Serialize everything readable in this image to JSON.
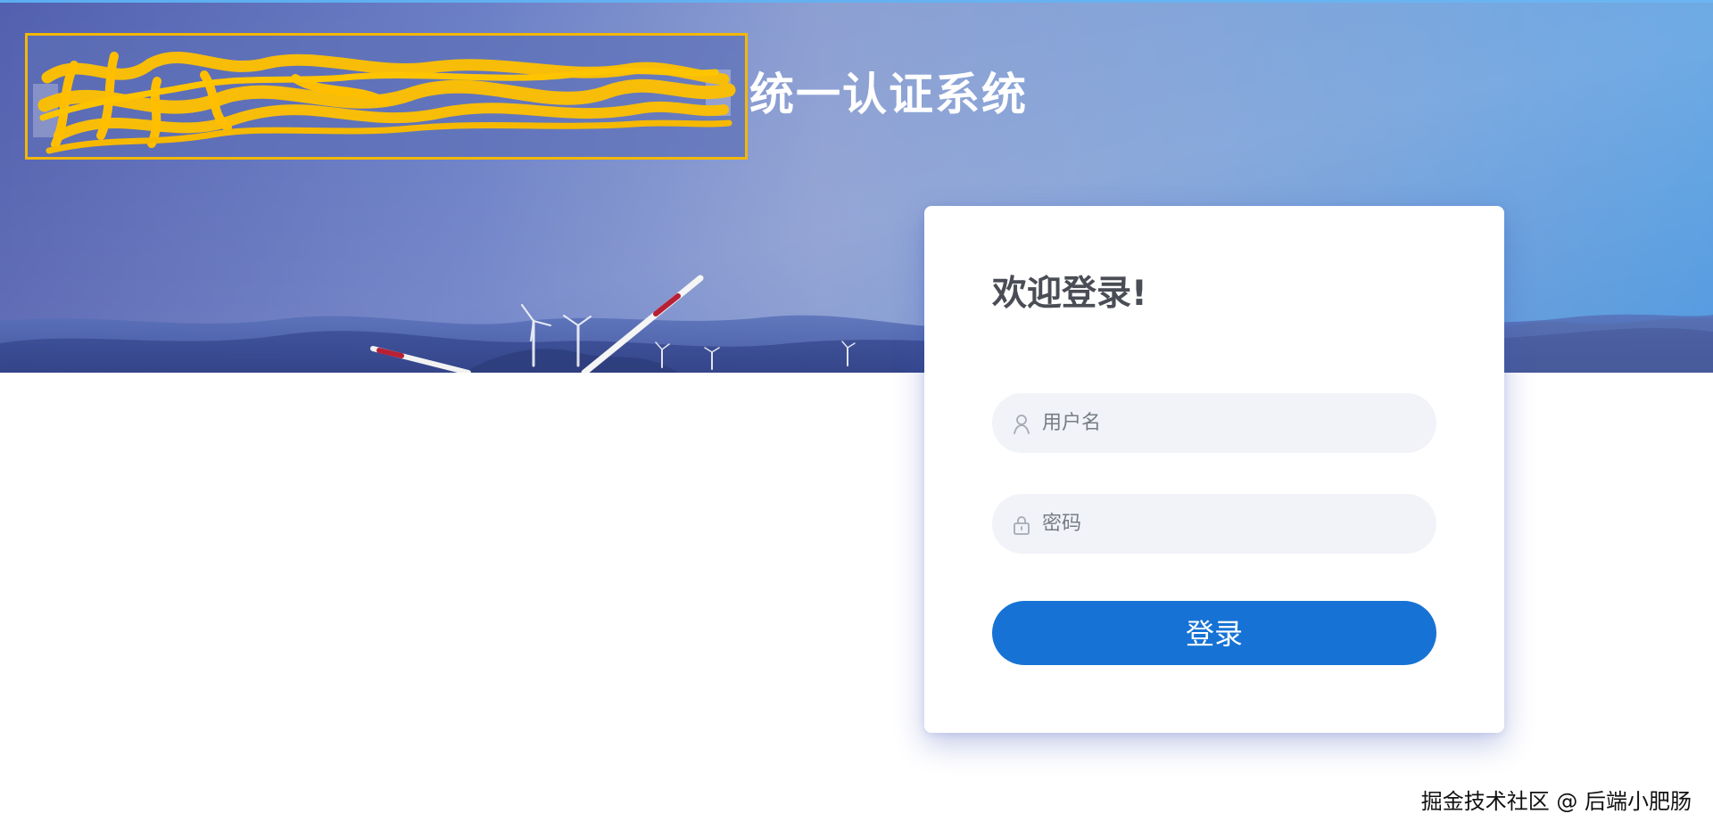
{
  "header": {
    "system_title": "统一认证系统"
  },
  "login": {
    "title": "欢迎登录!",
    "username": {
      "value": "",
      "placeholder": "用户名",
      "icon": "user-icon"
    },
    "password": {
      "value": "",
      "placeholder": "密码",
      "icon": "lock-icon"
    },
    "submit_label": "登录"
  },
  "footer": {
    "watermark": "掘金技术社区 @ 后端小肥肠"
  },
  "colors": {
    "primary_button": "#1673d5",
    "highlight_border": "#f3b706",
    "banner_start": "#4352a8",
    "banner_end": "#4f98df"
  }
}
